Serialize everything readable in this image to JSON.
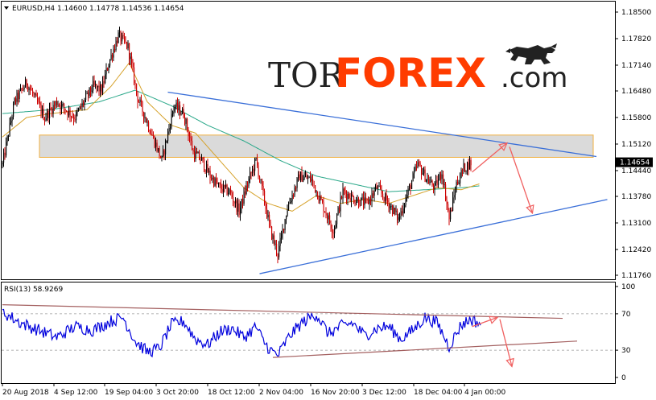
{
  "header": {
    "symbol_line": "EURUSD,H4  1.14600 1.14778 1.14536 1.14654",
    "rsi_line": "RSI(13) 58.9269"
  },
  "logo": {
    "part1": "TOR",
    "part2": "FOREX",
    "part3": ".com"
  },
  "colors": {
    "bull": "#000000",
    "bear": "#cc0000",
    "ma_fast": "#d6a22b",
    "ma_slow": "#2aa889",
    "trendline": "#3a6fd8",
    "zone_fill": "#d6d6d6",
    "zone_border": "#f0b040",
    "arrow": "#f06060",
    "rsi_line": "#0000dd",
    "rsi_trend": "#a46060",
    "logo_tor": "#222222",
    "logo_forex": "#ff3c00"
  },
  "chart_data": [
    {
      "type": "candlestick",
      "title": "EURUSD,H4",
      "symbol": "EURUSD",
      "timeframe": "H4",
      "ohlc_last": {
        "open": 1.146,
        "high": 1.14778,
        "low": 1.14536,
        "close": 1.14654
      },
      "current_price_label": "1.14654",
      "y_ticks": [
        "1.18500",
        "1.17820",
        "1.17140",
        "1.16480",
        "1.15800",
        "1.15120",
        "1.14440",
        "1.13780",
        "1.13100",
        "1.12420",
        "1.11760"
      ],
      "ylim": [
        1.1176,
        1.185
      ],
      "x_ticks": [
        "20 Aug 2018",
        "4 Sep 12:00",
        "19 Sep 04:00",
        "3 Oct 20:00",
        "18 Oct 12:00",
        "2 Nov 04:00",
        "16 Nov 20:00",
        "3 Dec 12:00",
        "18 Dec 04:00",
        "4 Jan 00:00"
      ],
      "path_keypoints": [
        {
          "i": 0,
          "p": 1.146
        },
        {
          "i": 10,
          "p": 1.162
        },
        {
          "i": 20,
          "p": 1.167
        },
        {
          "i": 35,
          "p": 1.158
        },
        {
          "i": 45,
          "p": 1.162
        },
        {
          "i": 60,
          "p": 1.158
        },
        {
          "i": 75,
          "p": 1.166
        },
        {
          "i": 82,
          "p": 1.165
        },
        {
          "i": 88,
          "p": 1.172
        },
        {
          "i": 96,
          "p": 1.179
        },
        {
          "i": 104,
          "p": 1.176
        },
        {
          "i": 112,
          "p": 1.163
        },
        {
          "i": 122,
          "p": 1.155
        },
        {
          "i": 132,
          "p": 1.147
        },
        {
          "i": 142,
          "p": 1.161
        },
        {
          "i": 150,
          "p": 1.159
        },
        {
          "i": 158,
          "p": 1.149
        },
        {
          "i": 165,
          "p": 1.147
        },
        {
          "i": 172,
          "p": 1.143
        },
        {
          "i": 180,
          "p": 1.14
        },
        {
          "i": 188,
          "p": 1.139
        },
        {
          "i": 196,
          "p": 1.134
        },
        {
          "i": 204,
          "p": 1.142
        },
        {
          "i": 210,
          "p": 1.147
        },
        {
          "i": 216,
          "p": 1.138
        },
        {
          "i": 222,
          "p": 1.129
        },
        {
          "i": 228,
          "p": 1.123
        },
        {
          "i": 236,
          "p": 1.135
        },
        {
          "i": 246,
          "p": 1.143
        },
        {
          "i": 256,
          "p": 1.142
        },
        {
          "i": 266,
          "p": 1.135
        },
        {
          "i": 274,
          "p": 1.129
        },
        {
          "i": 282,
          "p": 1.139
        },
        {
          "i": 292,
          "p": 1.137
        },
        {
          "i": 302,
          "p": 1.136
        },
        {
          "i": 310,
          "p": 1.14
        },
        {
          "i": 320,
          "p": 1.136
        },
        {
          "i": 328,
          "p": 1.132
        },
        {
          "i": 336,
          "p": 1.139
        },
        {
          "i": 344,
          "p": 1.146
        },
        {
          "i": 352,
          "p": 1.142
        },
        {
          "i": 358,
          "p": 1.14
        },
        {
          "i": 364,
          "p": 1.144
        },
        {
          "i": 370,
          "p": 1.132
        },
        {
          "i": 376,
          "p": 1.141
        },
        {
          "i": 382,
          "p": 1.145
        },
        {
          "i": 388,
          "p": 1.1465
        }
      ],
      "ma_slow": [
        {
          "i": 0,
          "p": 1.159
        },
        {
          "i": 40,
          "p": 1.16
        },
        {
          "i": 80,
          "p": 1.162
        },
        {
          "i": 110,
          "p": 1.165
        },
        {
          "i": 140,
          "p": 1.161
        },
        {
          "i": 170,
          "p": 1.156
        },
        {
          "i": 200,
          "p": 1.152
        },
        {
          "i": 230,
          "p": 1.147
        },
        {
          "i": 260,
          "p": 1.143
        },
        {
          "i": 290,
          "p": 1.141
        },
        {
          "i": 320,
          "p": 1.139
        },
        {
          "i": 350,
          "p": 1.1395
        },
        {
          "i": 380,
          "p": 1.14
        },
        {
          "i": 395,
          "p": 1.1405
        }
      ],
      "ma_fast": [
        {
          "i": 0,
          "p": 1.153
        },
        {
          "i": 20,
          "p": 1.158
        },
        {
          "i": 40,
          "p": 1.159
        },
        {
          "i": 70,
          "p": 1.16
        },
        {
          "i": 90,
          "p": 1.166
        },
        {
          "i": 105,
          "p": 1.172
        },
        {
          "i": 120,
          "p": 1.162
        },
        {
          "i": 140,
          "p": 1.156
        },
        {
          "i": 160,
          "p": 1.154
        },
        {
          "i": 180,
          "p": 1.147
        },
        {
          "i": 200,
          "p": 1.14
        },
        {
          "i": 220,
          "p": 1.136
        },
        {
          "i": 240,
          "p": 1.134
        },
        {
          "i": 260,
          "p": 1.138
        },
        {
          "i": 280,
          "p": 1.136
        },
        {
          "i": 300,
          "p": 1.137
        },
        {
          "i": 320,
          "p": 1.136
        },
        {
          "i": 340,
          "p": 1.138
        },
        {
          "i": 360,
          "p": 1.14
        },
        {
          "i": 380,
          "p": 1.1395
        },
        {
          "i": 395,
          "p": 1.141
        }
      ],
      "resistance_zone": [
        1.1478,
        1.1535
      ],
      "upper_trendline": [
        {
          "i": 137,
          "p": 1.1645
        },
        {
          "i": 492,
          "p": 1.148
        }
      ],
      "lower_trendline": [
        {
          "i": 213,
          "p": 1.118
        },
        {
          "i": 501,
          "p": 1.137
        }
      ],
      "forecast_arrows": [
        {
          "from": {
            "i": 389,
            "p": 1.144
          },
          "to": {
            "i": 418,
            "p": 1.1515
          }
        },
        {
          "from": {
            "i": 420,
            "p": 1.1505
          },
          "to": {
            "i": 439,
            "p": 1.1335
          }
        }
      ]
    },
    {
      "type": "line",
      "title": "RSI(13)",
      "current_value": 58.9269,
      "ylim": [
        0,
        100
      ],
      "y_ticks": [
        "100",
        "70",
        "30",
        "0"
      ],
      "levels": [
        70,
        30
      ],
      "keypoints": [
        {
          "i": 0,
          "v": 72
        },
        {
          "i": 15,
          "v": 60
        },
        {
          "i": 30,
          "v": 52
        },
        {
          "i": 45,
          "v": 44
        },
        {
          "i": 60,
          "v": 56
        },
        {
          "i": 75,
          "v": 52
        },
        {
          "i": 90,
          "v": 62
        },
        {
          "i": 100,
          "v": 66
        },
        {
          "i": 110,
          "v": 40
        },
        {
          "i": 120,
          "v": 28
        },
        {
          "i": 130,
          "v": 32
        },
        {
          "i": 140,
          "v": 58
        },
        {
          "i": 150,
          "v": 62
        },
        {
          "i": 160,
          "v": 42
        },
        {
          "i": 170,
          "v": 36
        },
        {
          "i": 180,
          "v": 50
        },
        {
          "i": 190,
          "v": 54
        },
        {
          "i": 200,
          "v": 44
        },
        {
          "i": 210,
          "v": 56
        },
        {
          "i": 216,
          "v": 40
        },
        {
          "i": 222,
          "v": 30
        },
        {
          "i": 228,
          "v": 24
        },
        {
          "i": 238,
          "v": 46
        },
        {
          "i": 248,
          "v": 60
        },
        {
          "i": 260,
          "v": 70
        },
        {
          "i": 270,
          "v": 48
        },
        {
          "i": 280,
          "v": 56
        },
        {
          "i": 290,
          "v": 60
        },
        {
          "i": 300,
          "v": 46
        },
        {
          "i": 310,
          "v": 54
        },
        {
          "i": 320,
          "v": 56
        },
        {
          "i": 330,
          "v": 42
        },
        {
          "i": 340,
          "v": 52
        },
        {
          "i": 350,
          "v": 66
        },
        {
          "i": 360,
          "v": 60
        },
        {
          "i": 370,
          "v": 34
        },
        {
          "i": 380,
          "v": 58
        },
        {
          "i": 388,
          "v": 64
        },
        {
          "i": 396,
          "v": 59
        }
      ],
      "upper_trendline": [
        {
          "i": 0,
          "v": 80
        },
        {
          "i": 464,
          "v": 65
        }
      ],
      "lower_trendline": [
        {
          "i": 224,
          "v": 22
        },
        {
          "i": 476,
          "v": 40
        }
      ],
      "forecast_arrows": [
        {
          "from": {
            "i": 389,
            "v": 56
          },
          "to": {
            "i": 410,
            "v": 66
          }
        },
        {
          "from": {
            "i": 412,
            "v": 64
          },
          "to": {
            "i": 422,
            "v": 12
          }
        }
      ]
    }
  ]
}
